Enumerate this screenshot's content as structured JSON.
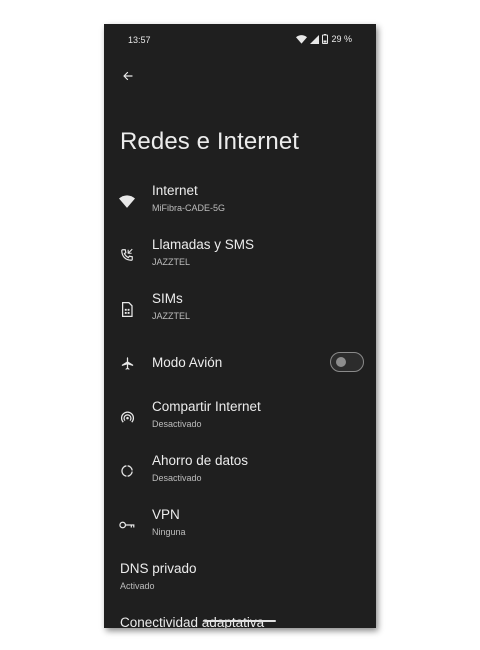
{
  "status_bar": {
    "time": "13:57",
    "battery": "29 %",
    "icons": [
      "wifi-icon",
      "signal-icon",
      "battery-icon"
    ]
  },
  "header": {
    "back_icon": "arrow-back-icon",
    "title": "Redes e Internet"
  },
  "settings": [
    {
      "title": "Internet",
      "subtitle": "MiFibra-CADE-5G",
      "icon": "wifi-icon"
    },
    {
      "title": "Llamadas y SMS",
      "subtitle": "JAZZTEL",
      "icon": "phone-icon"
    },
    {
      "title": "SIMs",
      "subtitle": "JAZZTEL",
      "icon": "sim-icon"
    },
    {
      "title": "Modo Avión",
      "subtitle": "",
      "icon": "airplane-icon",
      "toggle_on": false
    },
    {
      "title": "Compartir Internet",
      "subtitle": "Desactivado",
      "icon": "hotspot-icon"
    },
    {
      "title": "Ahorro de datos",
      "subtitle": "Desactivado",
      "icon": "data-saver-icon"
    },
    {
      "title": "VPN",
      "subtitle": "Ninguna",
      "icon": "vpn-key-icon"
    },
    {
      "title": "DNS privado",
      "subtitle": "Activado"
    },
    {
      "title": "Conectividad adaptativa",
      "subtitle": ""
    }
  ],
  "colors": {
    "background": "#1f1f1f",
    "text_primary": "#ececec",
    "text_secondary": "#bdbdbd",
    "toggle_off": "#8d8d8d"
  }
}
